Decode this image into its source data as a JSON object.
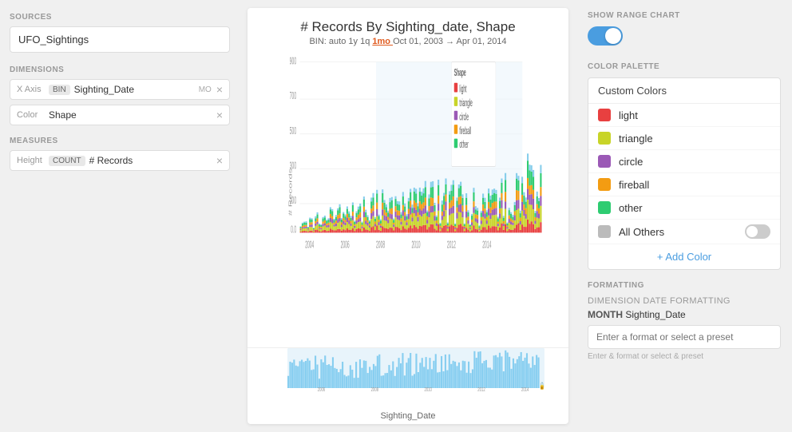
{
  "left": {
    "sources_label": "SOURCES",
    "source_value": "UFO_Sightings",
    "dimensions_label": "DIMENSIONS",
    "xaxis_label": "X Axis",
    "xaxis_tag": "BIN",
    "xaxis_value": "Sighting_Date",
    "xaxis_extra": "MO",
    "color_label": "Color",
    "color_value": "Shape",
    "measures_label": "MEASURES",
    "height_label": "Height",
    "height_tag": "COUNT",
    "height_value": "# Records"
  },
  "chart": {
    "title": "# Records By Sighting_date, Shape",
    "bin_label": "BIN:",
    "bin_options": [
      "auto",
      "1y",
      "1q"
    ],
    "bin_active": "1mo",
    "date_range": "Oct 01, 2003 → Apr 01, 2014",
    "legend_title": "Shape",
    "legend_items": [
      {
        "name": "light",
        "color": "#e84040"
      },
      {
        "name": "triangle",
        "color": "#c8d428"
      },
      {
        "name": "circle",
        "color": "#9b59b6"
      },
      {
        "name": "fireball",
        "color": "#f39c12"
      },
      {
        "name": "other",
        "color": "#2ecc71"
      }
    ],
    "y_axis_label": "# Records",
    "x_axis_label": "Sighting_Date",
    "x_ticks": [
      "2004",
      "2006",
      "2008",
      "2010",
      "2012",
      "2014"
    ],
    "y_max": 900
  },
  "right": {
    "show_range_label": "SHOW RANGE CHART",
    "color_palette_label": "COLOR PALETTE",
    "custom_colors_header": "Custom Colors",
    "colors": [
      {
        "name": "light",
        "color": "#e84040"
      },
      {
        "name": "triangle",
        "color": "#c8d428"
      },
      {
        "name": "circle",
        "color": "#9b59b6"
      },
      {
        "name": "fireball",
        "color": "#f39c12"
      },
      {
        "name": "other",
        "color": "#2ecc71"
      }
    ],
    "all_others_label": "All Others",
    "add_color_label": "+ Add Color",
    "formatting_label": "FORMATTING",
    "dim_date_label": "DIMENSION DATE FORMATTING",
    "month_label": "MONTH",
    "sighting_label": "Sighting_Date",
    "format_placeholder": "Enter a format or select a preset",
    "format_hint": "Enter & format or select & preset"
  }
}
